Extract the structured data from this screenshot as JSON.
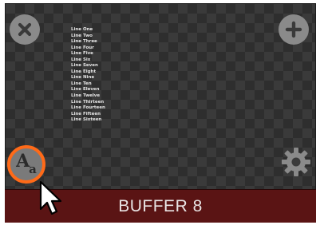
{
  "text_lines": [
    "Line One",
    "Line Two",
    "Line Three",
    "Line Four",
    "Line Five",
    "Line Six",
    "Line Seven",
    "Line Eight",
    "Line Nine",
    "Line Ten",
    "Line Eleven",
    "Line Twelve",
    "Line Thirteen",
    "Line Fourteen",
    "Line Fifteen",
    "Line Sixteen"
  ],
  "buffer": {
    "label": "BUFFER 8"
  },
  "colors": {
    "highlight_ring": "#ff6a18",
    "buffer_bar": "#5a1414",
    "icon_gray": "#8a8a8a"
  },
  "icons": {
    "close": "close-icon",
    "add": "add-icon",
    "font": "font-icon",
    "settings": "gear-icon",
    "pointer": "mouse-pointer-icon"
  }
}
